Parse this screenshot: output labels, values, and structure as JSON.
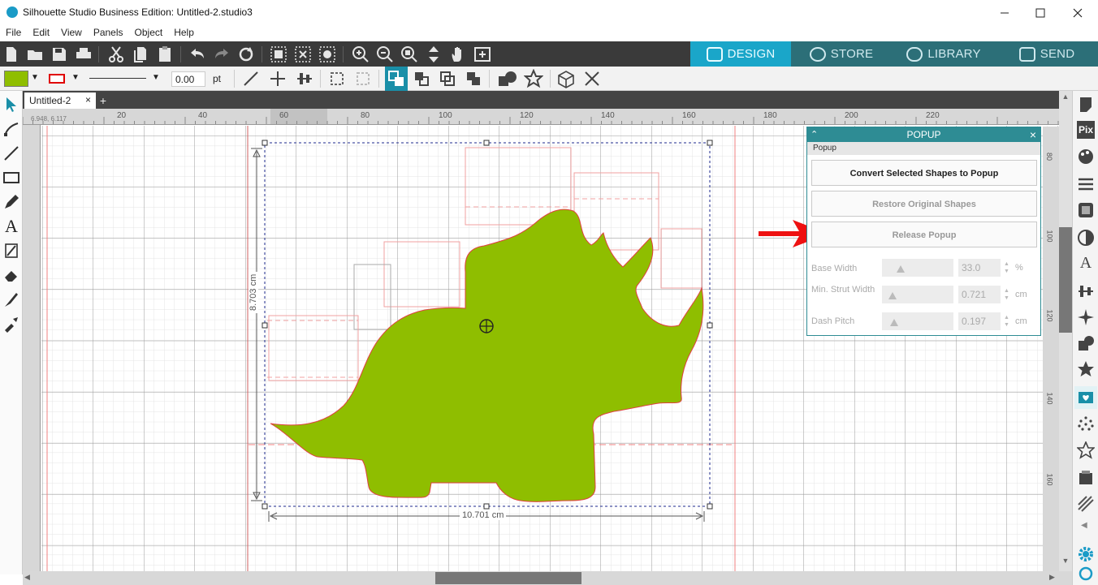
{
  "window": {
    "title": "Silhouette Studio Business Edition: Untitled-2.studio3"
  },
  "menu": [
    "File",
    "Edit",
    "View",
    "Panels",
    "Object",
    "Help"
  ],
  "nav_tabs": [
    {
      "label": "DESIGN",
      "icon": "grid-icon",
      "active": true
    },
    {
      "label": "STORE",
      "icon": "store-icon",
      "active": false
    },
    {
      "label": "LIBRARY",
      "icon": "cloud-icon",
      "active": false
    },
    {
      "label": "SEND",
      "icon": "cutter-icon",
      "active": false
    }
  ],
  "toolbar2": {
    "line_width": "0.00",
    "line_unit": "pt",
    "fill_color": "#8fbe00",
    "line_color": "#e00000"
  },
  "document_tab": {
    "name": "Untitled-2",
    "close": "×",
    "add": "+"
  },
  "ruler": {
    "coords": "6.948, 6.117",
    "h_labels": [
      "20",
      "40",
      "60",
      "80",
      "100",
      "120",
      "140",
      "160",
      "180",
      "200",
      "220"
    ],
    "v_labels": [
      "80",
      "100",
      "120",
      "140",
      "160"
    ]
  },
  "canvas": {
    "height_label": "8.703 cm",
    "width_label": "10.701 cm",
    "shape_color": "#8fbe00",
    "accent_color": "#e00000"
  },
  "popup_panel": {
    "title": "POPUP",
    "close": "×",
    "section": "Popup",
    "buttons": {
      "convert": "Convert Selected Shapes to Popup",
      "restore": "Restore Original Shapes",
      "release": "Release Popup"
    },
    "fields": {
      "base_width": {
        "label": "Base Width",
        "value": "33.0",
        "unit": "%"
      },
      "min_strut_width": {
        "label": "Min. Strut Width",
        "value": "0.721",
        "unit": "cm"
      },
      "dash_pitch": {
        "label": "Dash Pitch",
        "value": "0.197",
        "unit": "cm"
      }
    }
  }
}
